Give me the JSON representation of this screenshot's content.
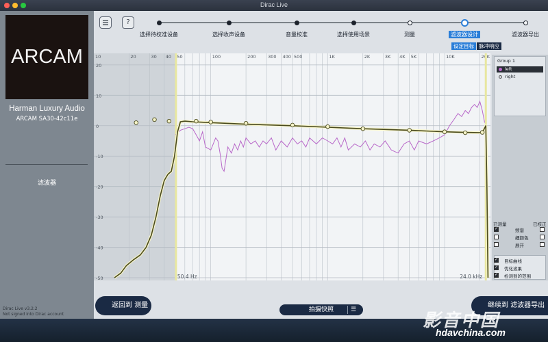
{
  "window": {
    "title": "Dirac Live"
  },
  "sidebar": {
    "logo_text": "ARCAM",
    "brand": "Harman Luxury Audio",
    "device": "ARCAM SA30-42c11e",
    "nav_item": "滤波器",
    "version": "Dirac Live v3.2.2",
    "signin": "Not signed into Dirac account"
  },
  "toolbar": {
    "menu_icon": "menu-icon",
    "help_label": "?"
  },
  "steps": [
    {
      "label": "选择待校准设备",
      "state": "done"
    },
    {
      "label": "选择收声设备",
      "state": "done"
    },
    {
      "label": "音量校准",
      "state": "done"
    },
    {
      "label": "选择使用场景",
      "state": "done"
    },
    {
      "label": "测量",
      "state": "todo"
    },
    {
      "label": "滤波器设计",
      "state": "active"
    },
    {
      "label": "滤波器导出",
      "state": "todo"
    }
  ],
  "subtabs": {
    "target": "设定目标",
    "impulse": "脉冲响应"
  },
  "colors": {
    "accent": "#2a7ed8",
    "target_curve": "#4a4a1e",
    "target_outline": "#f5f3c8",
    "measurement": "#b867c9",
    "range_marker": "#e8e7a0"
  },
  "chart_data": {
    "type": "line",
    "x_scale": "log",
    "xlim": [
      10,
      24000
    ],
    "ylim": [
      -50,
      22
    ],
    "x_ticks": [
      10,
      20,
      30,
      40,
      50,
      100,
      200,
      300,
      400,
      500,
      1000,
      2000,
      3000,
      4000,
      5000,
      10000,
      20000
    ],
    "x_tick_labels": [
      "10",
      "20",
      "30",
      "40",
      "50",
      "100",
      "200",
      "300",
      "400",
      "500",
      "1K",
      "2K",
      "3K",
      "4K",
      "5K",
      "10K",
      "20K"
    ],
    "y_ticks": [
      20,
      10,
      0,
      -10,
      -20,
      -30,
      -40,
      -50
    ],
    "y_tick_labels": [
      "20",
      "10",
      "0",
      "-10",
      "-20",
      "-30",
      "-40",
      "-50"
    ],
    "range_low_label": "50.4 Hz",
    "range_high_label": "24.0 kHz",
    "range": [
      50.4,
      24000
    ],
    "target_x": [
      15,
      17,
      19,
      22,
      25,
      28,
      31,
      34,
      37,
      40,
      43,
      46,
      49,
      52,
      55,
      60,
      70,
      100,
      200,
      500,
      1000,
      2000,
      5000,
      10000,
      15000,
      21000,
      22500,
      23000,
      23500
    ],
    "target_y": [
      -50,
      -48.5,
      -46,
      -44,
      -42.5,
      -40,
      -36,
      -30,
      -23,
      -18,
      -16,
      -15,
      -10,
      -2,
      1.3,
      1.5,
      1.3,
      1,
      0.5,
      0,
      -0.5,
      -1,
      -1.5,
      -2,
      -2.2,
      -2.3,
      0,
      -20,
      -50
    ],
    "target_handles_x": [
      23,
      33,
      44,
      75,
      100,
      200,
      500,
      1000,
      2000,
      5000,
      10000,
      15000,
      21000
    ],
    "target_handles_y": [
      1,
      2,
      1.5,
      1.5,
      1.2,
      0.8,
      0.2,
      -0.3,
      -1,
      -1.5,
      -2,
      -2.3,
      -2.2
    ],
    "measurement_x": [
      50,
      55,
      60,
      65,
      70,
      75,
      80,
      85,
      90,
      95,
      100,
      105,
      110,
      115,
      120,
      125,
      130,
      140,
      150,
      160,
      170,
      180,
      190,
      200,
      220,
      240,
      260,
      280,
      300,
      330,
      360,
      400,
      450,
      500,
      550,
      600,
      650,
      700,
      800,
      900,
      1000,
      1100,
      1200,
      1300,
      1400,
      1500,
      1700,
      1900,
      2100,
      2300,
      2500,
      2800,
      3100,
      3500,
      4000,
      4500,
      5000,
      5500,
      6000,
      7000,
      8000,
      9000,
      10000,
      11000,
      12000,
      13000,
      14000,
      15000,
      16000,
      17000,
      18000,
      19000,
      20000,
      21000,
      22000
    ],
    "measurement_y": [
      -3,
      -1.5,
      -1,
      -0.5,
      -1,
      -3,
      -5,
      -2,
      -7,
      -7.5,
      -8,
      -6,
      -4,
      -5,
      -9,
      -14,
      -15,
      -7,
      -9,
      -6,
      -8,
      -5,
      -7,
      -4,
      -6,
      -5,
      -7,
      -5,
      -6,
      -4,
      -8,
      -5,
      -7,
      -4,
      -6,
      -5,
      -7,
      -4,
      -6,
      -4,
      -5,
      -6,
      -4,
      -7,
      -4,
      -8,
      -6,
      -7,
      -5,
      -8,
      -6,
      -7,
      -5,
      -8,
      -9,
      -6,
      -5,
      -8,
      -5,
      -6,
      -5,
      -4,
      -3,
      0,
      2,
      4,
      3,
      5,
      4,
      6,
      7,
      6,
      8,
      5,
      1
    ]
  },
  "right_panel": {
    "group_title": "Group 1",
    "channels": [
      {
        "name": "left",
        "color": "#b867c9",
        "selected": true
      },
      {
        "name": "right",
        "color": "#d9dde2",
        "selected": false
      }
    ],
    "header_measured": "已测量",
    "header_corrected": "已校正",
    "options": [
      {
        "label": "频谱",
        "left": true,
        "right": false
      },
      {
        "label": "细颜色",
        "left": false,
        "right": false
      },
      {
        "label": "展开",
        "left": false,
        "right": false
      }
    ],
    "toggles": [
      {
        "label": "目标曲线",
        "checked": true
      },
      {
        "label": "优化滤果",
        "checked": true
      },
      {
        "label": "检测到的范围",
        "checked": true
      }
    ]
  },
  "bottom": {
    "back_label": "返回到 测量",
    "next_label": "继续到 滤波器导出",
    "snapshot_label": "拍摄快照"
  },
  "watermark": {
    "title": "影音中国",
    "url": "hdavchina.com"
  }
}
